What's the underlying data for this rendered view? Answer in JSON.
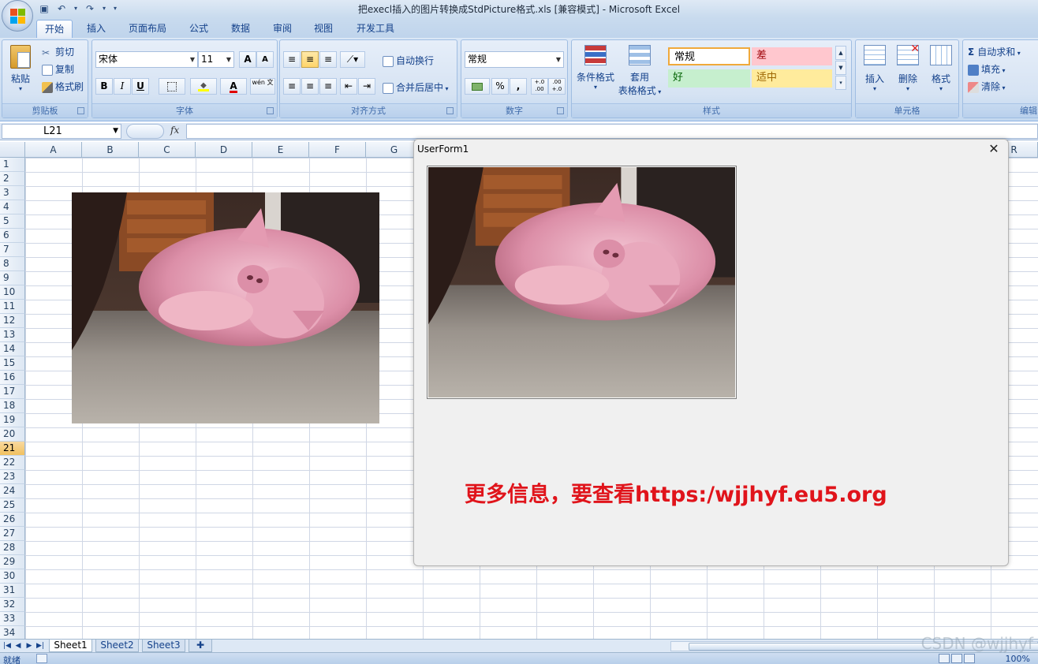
{
  "window": {
    "title": "把execl插入的图片转换成StdPicture格式.xls  [兼容模式] - Microsoft Excel"
  },
  "ribbon": {
    "tabs": [
      "开始",
      "插入",
      "页面布局",
      "公式",
      "数据",
      "审阅",
      "视图",
      "开发工具"
    ],
    "active_tab": "开始",
    "clipboard": {
      "paste": "粘贴",
      "cut": "剪切",
      "copy": "复制",
      "format_painter": "格式刷",
      "label": "剪贴板"
    },
    "font": {
      "name": "宋体",
      "size": "11",
      "bold": "B",
      "italic": "I",
      "underline": "U",
      "grow": "A",
      "shrink": "A",
      "font_color": "A",
      "phonetic": "wén 文",
      "label": "字体"
    },
    "alignment": {
      "wrap_text": "自动换行",
      "merge_center": "合并后居中",
      "label": "对齐方式"
    },
    "number": {
      "format": "常规",
      "percent": "%",
      "comma": ",",
      "inc_decimal": "+.0 .00",
      "dec_decimal": ".00 +.0",
      "label": "数字"
    },
    "styles": {
      "conditional_format": "条件格式",
      "table_format_line1": "套用",
      "table_format_line2": "表格格式",
      "cell_styles": [
        {
          "name": "常规",
          "bg": "#ffffff",
          "fg": "#000000"
        },
        {
          "name": "差",
          "bg": "#ffc7ce",
          "fg": "#9c0006"
        },
        {
          "name": "好",
          "bg": "#c6efce",
          "fg": "#006100"
        },
        {
          "name": "适中",
          "bg": "#ffeb9c",
          "fg": "#9c6500"
        }
      ],
      "label": "样式"
    },
    "cells": {
      "insert": "插入",
      "delete": "删除",
      "format": "格式",
      "label": "单元格"
    },
    "editing": {
      "autosum": "自动求和",
      "fill": "填充",
      "clear": "清除",
      "label": "编辑"
    }
  },
  "formula_bar": {
    "name_box": "L21",
    "fx": "fx",
    "formula": ""
  },
  "sheet": {
    "columns": [
      "A",
      "B",
      "C",
      "D",
      "E",
      "F",
      "G",
      "R"
    ],
    "rows": [
      "1",
      "2",
      "3",
      "4",
      "5",
      "6",
      "7",
      "8",
      "9",
      "10",
      "11",
      "12",
      "13",
      "14",
      "15",
      "16",
      "17",
      "18",
      "19",
      "20",
      "21",
      "22",
      "23",
      "24",
      "25",
      "26",
      "27",
      "28",
      "29",
      "30",
      "31",
      "32",
      "33",
      "34"
    ],
    "selected_row": "21"
  },
  "userform": {
    "title": "UserForm1",
    "close": "✕",
    "message": "更多信息，要查看https:/wjjhyf.eu5.org"
  },
  "sheet_tabs": {
    "tabs": [
      "Sheet1",
      "Sheet2",
      "Sheet3"
    ],
    "active": "Sheet1"
  },
  "status_bar": {
    "ready": "就绪",
    "zoom": "100%"
  },
  "watermark": "CSDN @wjjhyf"
}
